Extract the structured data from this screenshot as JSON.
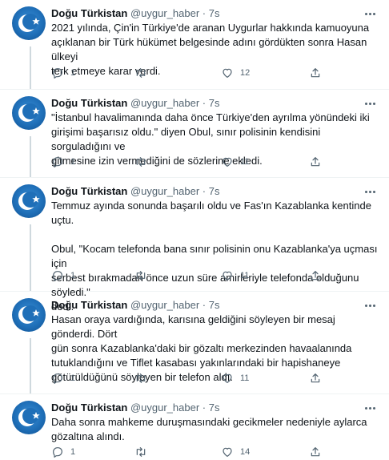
{
  "author": {
    "name": "Doğu Türkistan",
    "handle": "@uygur_haber",
    "separator": "·",
    "time": "7s"
  },
  "tweets": [
    {
      "text": "2021 yılında, Çin'in Türkiye'de aranan Uygurlar hakkında kamuoyuna\naçıklanan bir Türk hükümet belgesinde adını gördükten sonra Hasan ülkeyi\nterk etmeye karar verdi.",
      "replies": "1",
      "retweets": "",
      "likes": "12"
    },
    {
      "text": "\"İstanbul havalimanında daha önce Türkiye'den ayrılma yönündeki iki\ngirişimi başarısız oldu.\" diyen Obul, sınır polisinin kendisini sorguladığını ve\ngitmesine izin vermediğini de sözlerine ekledi.",
      "replies": "1",
      "retweets": "",
      "likes": "11"
    },
    {
      "text": "Temmuz ayında sonunda başarılı oldu ve Fas'ın Kazablanka kentinde uçtu.\n\nObul, \"Kocam telefonda bana sınır polisinin onu Kazablanka'ya uçması için\nserbest bırakmadan önce uzun süre amirleriyle telefonda olduğunu söyledi.\"\ndedi.",
      "replies": "1",
      "retweets": "",
      "likes": "11"
    },
    {
      "text": "Hasan oraya vardığında, karısına geldiğini söyleyen bir mesaj gönderdi. Dört\ngün sonra Kazablanka'daki bir gözaltı merkezinden havaalanında\ntutuklandığını ve Tiflet kasabası yakınlarındaki bir hapishaneye\ngötürüldüğünü söyleyen bir telefon aldı.",
      "replies": "1",
      "retweets": "",
      "likes": "11"
    },
    {
      "text": "Daha sonra mahkeme duruşmasındaki gecikmeler nedeniyle aylarca\ngözaltına alındı.",
      "replies": "1",
      "retweets": "",
      "likes": "14"
    }
  ],
  "icons": {
    "reply": "reply-icon",
    "retweet": "retweet-icon",
    "like": "like-icon",
    "share": "share-icon",
    "more": "more-icon",
    "avatar": "avatar"
  },
  "colors": {
    "text": "#0f1419",
    "secondary": "#536471",
    "thread_line": "#cfd9de",
    "divider": "#eff3f4",
    "avatar_blue": "#1f6fb8"
  }
}
